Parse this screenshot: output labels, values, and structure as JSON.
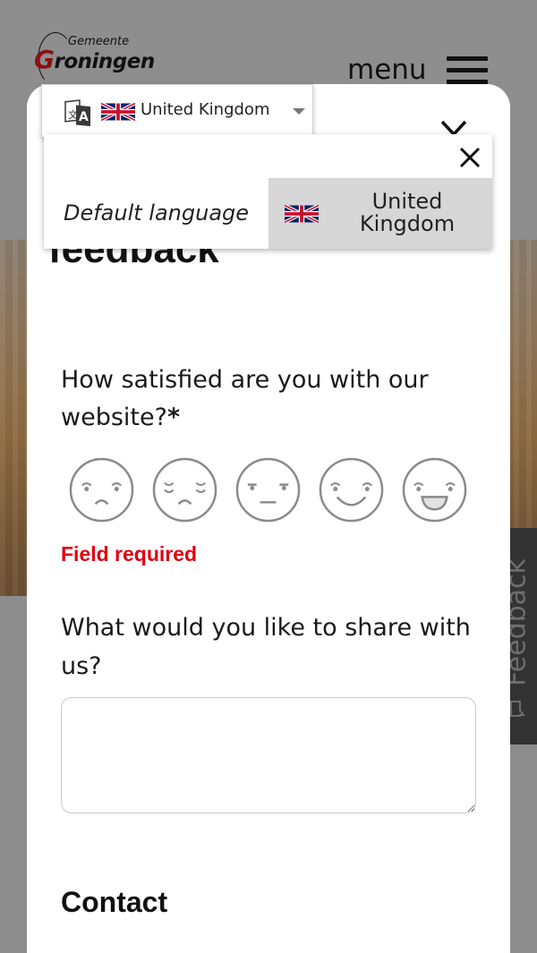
{
  "site": {
    "logo_small": "Gemeente",
    "logo_big_first": "G",
    "logo_big_rest": "roningen",
    "menu_label": "menu",
    "side_tab_label": "Feedback"
  },
  "modal": {
    "title": "feedback",
    "question_satisfaction": "How satisfied are you with our website?",
    "required_marker": "*",
    "rating_faces": [
      "very-unsatisfied-face-icon",
      "unsatisfied-face-icon",
      "neutral-face-icon",
      "satisfied-face-icon",
      "very-satisfied-face-icon"
    ],
    "error_text": "Field required",
    "question_share": "What would you like to share with us?",
    "share_value": "",
    "contact_heading": "Contact"
  },
  "language": {
    "selected_label": "United Kingdom",
    "options": [
      {
        "label": "Default language",
        "flag": ""
      },
      {
        "label": "United Kingdom",
        "flag": "uk-flag-icon",
        "selected": true
      }
    ]
  },
  "colors": {
    "error": "#e0000d",
    "logo_accent": "#8a1010",
    "overlay": "#8d8d8d",
    "selected_option": "#d6d6d6"
  }
}
